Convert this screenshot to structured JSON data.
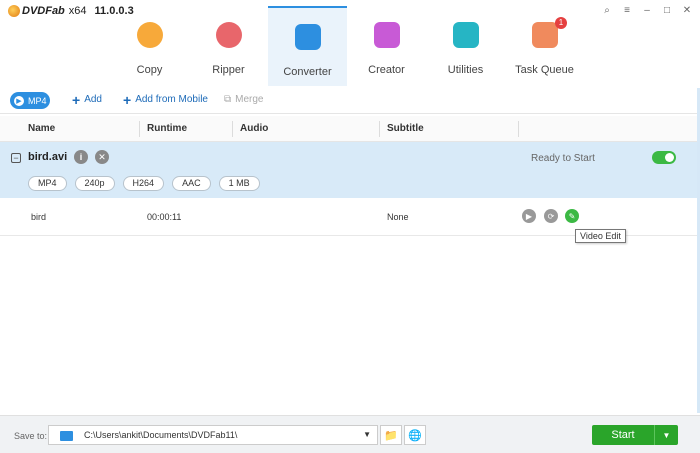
{
  "app": {
    "brand": "DVDFab",
    "arch": "x64",
    "version": "11.0.0.3"
  },
  "window_controls": [
    "pin-icon",
    "menu-icon",
    "minimize-icon",
    "maximize-icon",
    "close-icon"
  ],
  "nav": [
    {
      "label": "Copy",
      "icon": "copy-icon",
      "color": "#f7a93a"
    },
    {
      "label": "Ripper",
      "icon": "ripper-icon",
      "color": "#e8666b"
    },
    {
      "label": "Converter",
      "icon": "converter-icon",
      "color": "#2d8fe0",
      "active": true
    },
    {
      "label": "Creator",
      "icon": "creator-icon",
      "color": "#c85ad6"
    },
    {
      "label": "Utilities",
      "icon": "utilities-icon",
      "color": "#26b5c4"
    },
    {
      "label": "Task Queue",
      "icon": "task-queue-icon",
      "color": "#f08a5d",
      "badge": "1"
    }
  ],
  "toolbar": {
    "format": "MP4",
    "add": "Add",
    "add_mobile": "Add from Mobile",
    "merge": "Merge"
  },
  "columns": {
    "name": "Name",
    "runtime": "Runtime",
    "audio": "Audio",
    "subtitle": "Subtitle"
  },
  "file": {
    "name": "bird.avi",
    "status": "Ready to Start",
    "enabled": true,
    "chips": [
      "MP4",
      "240p",
      "H264",
      "AAC",
      "1 MB"
    ]
  },
  "title_row": {
    "name": "bird",
    "runtime": "00:00:11",
    "subtitle": "None"
  },
  "tooltip": "Video Edit",
  "footer": {
    "save_label": "Save to:",
    "path": "C:\\Users\\ankit\\Documents\\DVDFab11\\",
    "start": "Start"
  },
  "colors": {
    "accent": "#2d8fe0",
    "start": "#2aa52a",
    "selected_row": "#d8eaf8"
  }
}
